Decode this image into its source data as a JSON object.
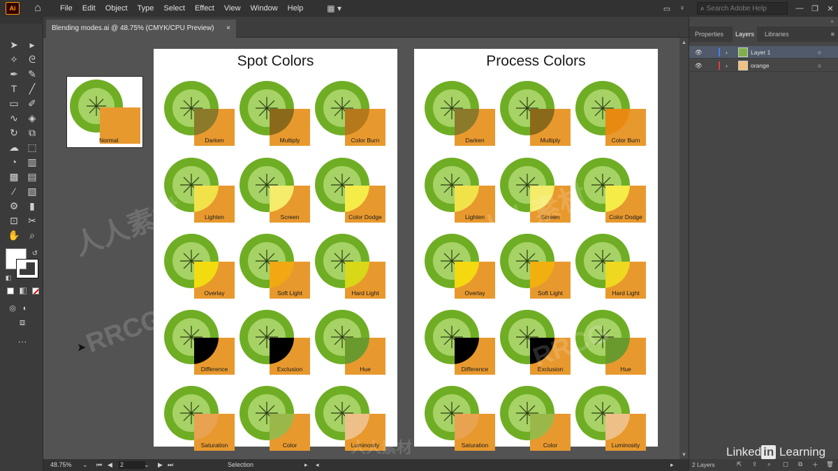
{
  "app": {
    "logo": "Ai"
  },
  "menu": [
    "File",
    "Edit",
    "Object",
    "Type",
    "Select",
    "Effect",
    "View",
    "Window",
    "Help"
  ],
  "search": {
    "placeholder": "Search Adobe Help"
  },
  "document": {
    "tab_title": "Blending modes.ai @ 48.75% (CMYK/CPU Preview)",
    "close": "×"
  },
  "normal_board": {
    "label": "Normal"
  },
  "artboards": [
    {
      "title": "Spot Colors",
      "modes": [
        "Darken",
        "Multiply",
        "Color Burn",
        "Lighten",
        "Screen",
        "Color Dodge",
        "Overlay",
        "Soft Light",
        "Hard Light",
        "Difference",
        "Exclusion",
        "Hue",
        "Saturation",
        "Color",
        "Luminosity"
      ],
      "overlap_colors": [
        "#8a7a2a",
        "#8a6a1a",
        "#b5781a",
        "#f2e24a",
        "#f4ec6a",
        "#f6ec48",
        "#f2dc10",
        "#f2a812",
        "#d8d818",
        "#000000",
        "#000000",
        "#6a9a2e",
        "#e8a250",
        "#9ab84a",
        "#eec088"
      ]
    },
    {
      "title": "Process Colors",
      "modes": [
        "Darken",
        "Multiply",
        "Color Burn",
        "Lighten",
        "Screen",
        "Color Dodge",
        "Overlay",
        "Soft Light",
        "Hard Light",
        "Difference",
        "Exclusion",
        "Hue",
        "Saturation",
        "Color",
        "Luminosity"
      ],
      "overlap_colors": [
        "#8a7a2a",
        "#8a6a1a",
        "#e88a10",
        "#f2e24a",
        "#f4ec6a",
        "#f6ec48",
        "#f4d810",
        "#f2b010",
        "#eed820",
        "#000000",
        "#000000",
        "#6a9a2e",
        "#e8a250",
        "#9ab84a",
        "#eec088"
      ]
    }
  ],
  "colors": {
    "lime_outer": "#6fae24",
    "lime_inner": "#a6d266",
    "orange": "#e8992e",
    "canvas": "#535353"
  },
  "layers": [
    {
      "name": "Layer 1",
      "color": "#4c7cf0",
      "selected": true
    },
    {
      "name": "orange",
      "color": "#e04040",
      "selected": false
    }
  ],
  "panel": {
    "tabs": [
      "Properties",
      "Layers",
      "Libraries"
    ],
    "active_tab": "Layers",
    "footer": "2 Layers"
  },
  "status": {
    "zoom": "48.75%",
    "page": "2",
    "tool": "Selection"
  },
  "branding": {
    "left": "Linked",
    "box": "in",
    "right": " Learning"
  },
  "watermarks": [
    "RRCG",
    "人人素材"
  ]
}
